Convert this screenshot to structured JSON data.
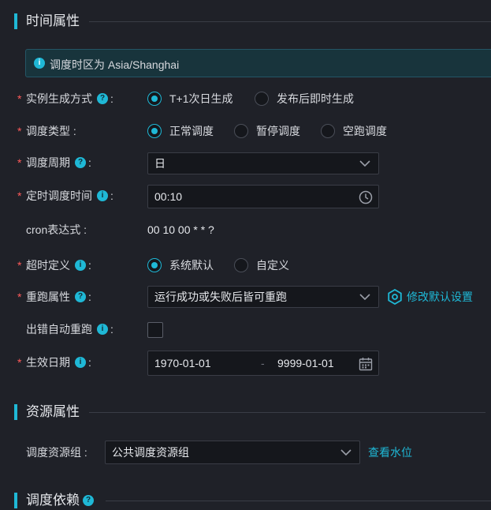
{
  "sections": {
    "time_props": "时间属性",
    "resource_props": "资源属性",
    "dependency": "调度依赖"
  },
  "info_banner": "调度时区为 Asia/Shanghai",
  "instance_gen": {
    "label": "实例生成方式",
    "options": [
      "T+1次日生成",
      "发布后即时生成"
    ],
    "selected": "T+1次日生成"
  },
  "sched_type": {
    "label": "调度类型",
    "options": [
      "正常调度",
      "暂停调度",
      "空跑调度"
    ],
    "selected": "正常调度"
  },
  "sched_cycle": {
    "label": "调度周期",
    "value": "日"
  },
  "sched_time": {
    "label": "定时调度时间",
    "value": "00:10"
  },
  "cron": {
    "label": "cron表达式",
    "value": "00 10 00 * * ?"
  },
  "timeout": {
    "label": "超时定义",
    "options": [
      "系统默认",
      "自定义"
    ],
    "selected": "系统默认"
  },
  "rerun": {
    "label": "重跑属性",
    "value": "运行成功或失败后皆可重跑",
    "link": "修改默认设置"
  },
  "auto_rerun": {
    "label": "出错自动重跑",
    "checked": false
  },
  "effective_date": {
    "label": "生效日期",
    "start": "1970-01-01",
    "end": "9999-01-01",
    "separator": "-"
  },
  "resource_group": {
    "label": "调度资源组",
    "value": "公共调度资源组",
    "link": "查看水位"
  },
  "colors": {
    "accent": "#1fb8d6",
    "required": "#ff5a5a",
    "background": "#1f2128"
  },
  "icons": {
    "help": "question-circle-icon",
    "info": "info-circle-icon",
    "clock": "clock-icon",
    "calendar": "calendar-icon",
    "chevron": "chevron-down-icon",
    "gear": "gear-icon"
  }
}
